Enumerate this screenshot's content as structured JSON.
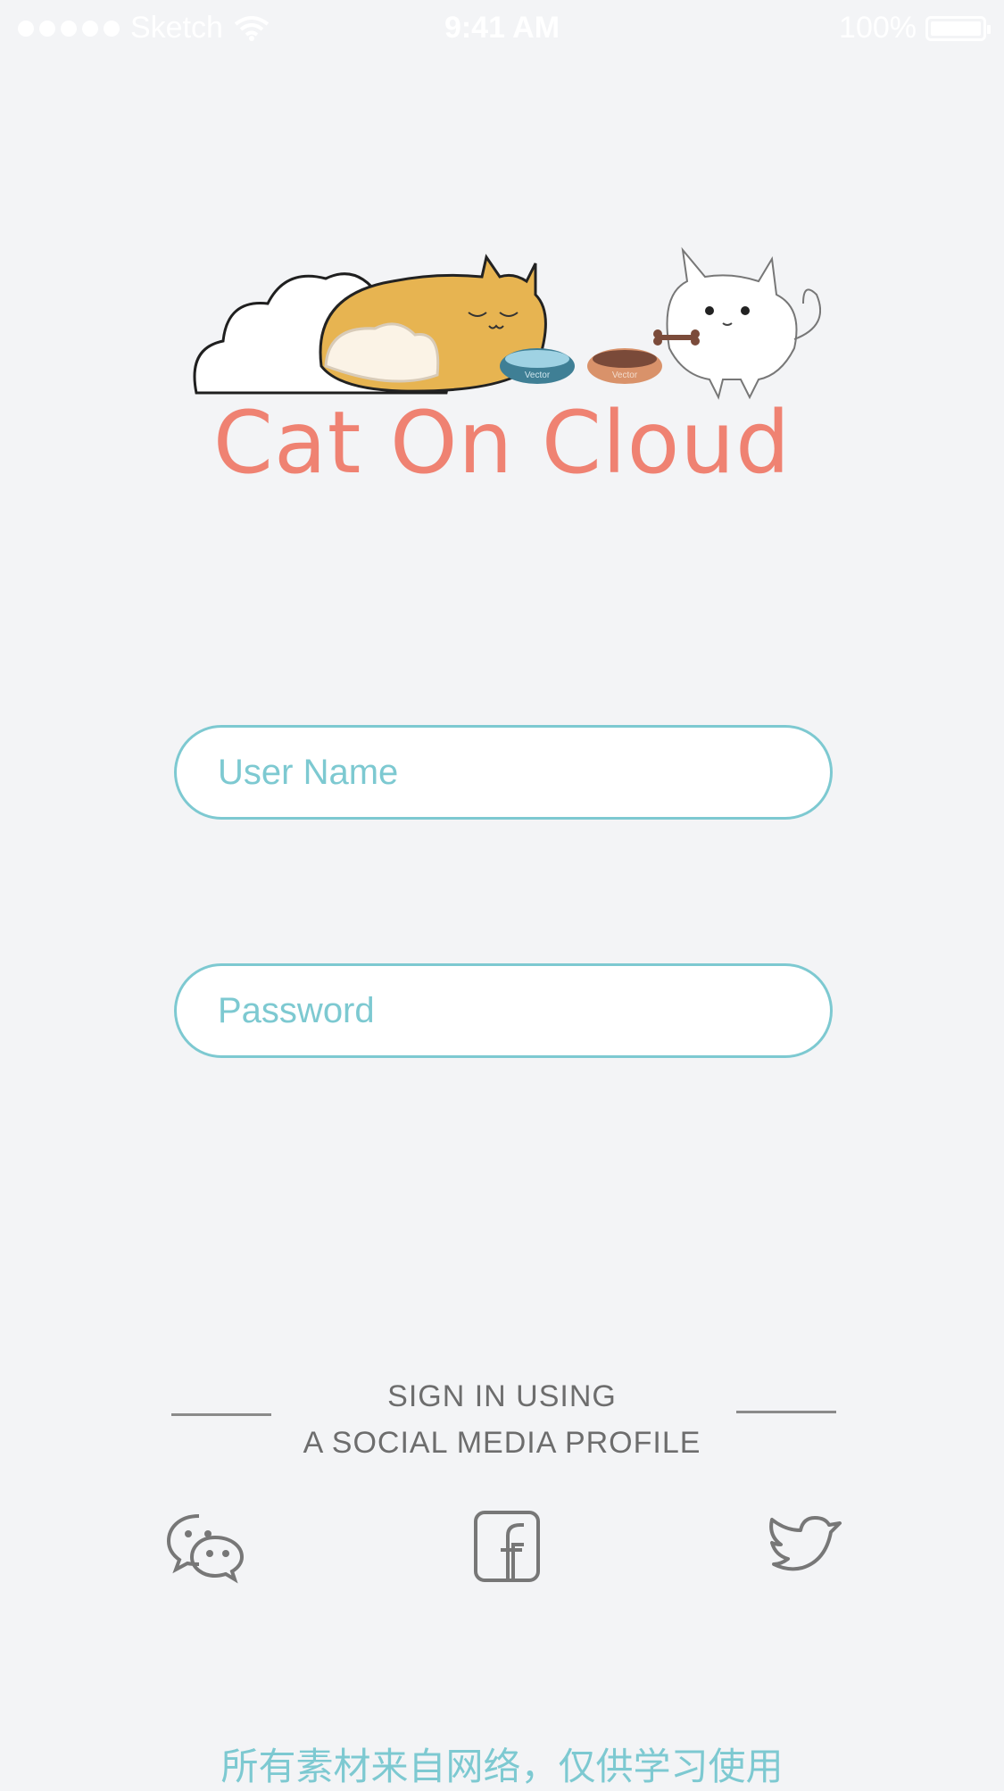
{
  "status_bar": {
    "carrier": "Sketch",
    "time": "9:41 AM",
    "battery": "100%",
    "battery_level": 1.0
  },
  "app": {
    "title": "Cat On Cloud",
    "illustration_labels": {
      "bowl_left": "Vector",
      "bowl_right": "Vector"
    }
  },
  "form": {
    "username_placeholder": "User Name",
    "password_placeholder": "Password"
  },
  "social": {
    "heading_line1": "SIGN IN USING",
    "heading_line2": "A SOCIAL MEDIA PROFILE",
    "icons": [
      "wechat-icon",
      "facebook-icon",
      "twitter-icon"
    ]
  },
  "footer": {
    "note": "所有素材来自网络，仅供学习使用"
  },
  "colors": {
    "background": "#f3f4f6",
    "title": "#ef8272",
    "accent": "#7dc9d1",
    "text_muted": "#6d6d6d"
  }
}
